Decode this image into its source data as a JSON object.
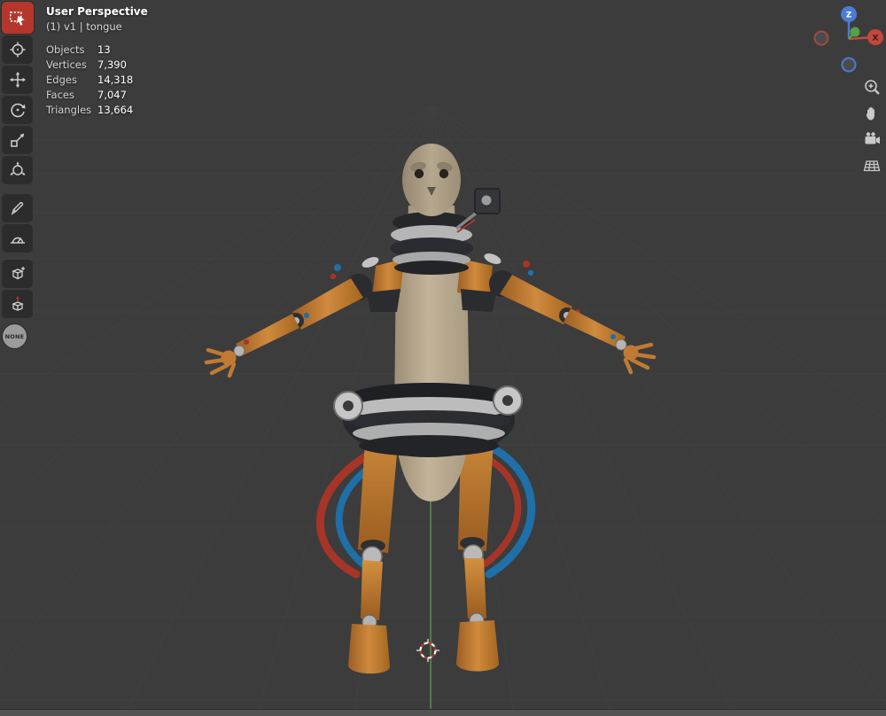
{
  "header": {
    "title": "User Perspective",
    "subtitle": "(1) v1 | tongue"
  },
  "stats": {
    "rows": [
      {
        "label": "Objects",
        "value": "13"
      },
      {
        "label": "Vertices",
        "value": "7,390"
      },
      {
        "label": "Edges",
        "value": "14,318"
      },
      {
        "label": "Faces",
        "value": "7,047"
      },
      {
        "label": "Triangles",
        "value": "13,664"
      }
    ]
  },
  "toolbar": {
    "none_label": "NONE",
    "tools": [
      "select-box",
      "cursor",
      "move",
      "rotate",
      "scale",
      "transform",
      "annotate",
      "measure",
      "add-cube",
      "extra-tool"
    ]
  },
  "gizmo": {
    "z_label": "Z",
    "x_label": "X"
  },
  "side_controls": [
    "zoom",
    "pan-hand",
    "camera-view",
    "toggle-projection"
  ],
  "scene": {
    "object": "robot-ostrich-character",
    "cursor_3d": "bottom-center"
  },
  "colors": {
    "viewport_bg": "#3c3c3c",
    "active_tool_red": "#b5362c",
    "axis_green": "#5a9c48",
    "axis_x_red": "#c4473d",
    "axis_z_blue": "#4a7bd6",
    "cable_blue": "#1f6fa8",
    "cable_red": "#a63528",
    "body_tan": "#b5a68d",
    "limb_orange": "#c47a31"
  }
}
